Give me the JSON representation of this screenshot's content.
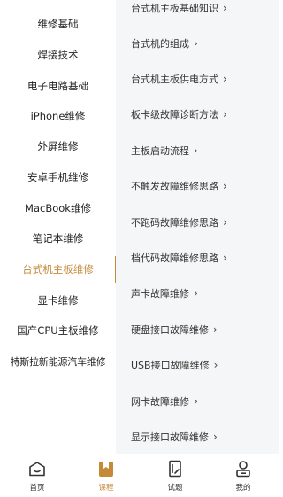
{
  "sidebar": {
    "items": [
      {
        "label": "维修基础"
      },
      {
        "label": "焊接技术"
      },
      {
        "label": "电子电路基础"
      },
      {
        "label": "iPhone维修"
      },
      {
        "label": "外屏维修"
      },
      {
        "label": "安卓手机维修"
      },
      {
        "label": "MacBook维修"
      },
      {
        "label": "笔记本维修"
      },
      {
        "label": "台式机主板维修",
        "active": true
      },
      {
        "label": "显卡维修"
      },
      {
        "label": "国产CPU主板维修"
      },
      {
        "label": "特斯拉新能源汽车维修"
      }
    ]
  },
  "content": {
    "items": [
      {
        "label": "台式机主板基础知识"
      },
      {
        "label": "台式机的组成"
      },
      {
        "label": "台式机主板供电方式"
      },
      {
        "label": "板卡级故障诊断方法"
      },
      {
        "label": "主板启动流程"
      },
      {
        "label": "不触发故障维修思路"
      },
      {
        "label": "不跑码故障维修思路"
      },
      {
        "label": "档代码故障维修思路"
      },
      {
        "label": "声卡故障维修"
      },
      {
        "label": "硬盘接口故障维修"
      },
      {
        "label": "USB接口故障维修"
      },
      {
        "label": "网卡故障维修"
      },
      {
        "label": "显示接口故障维修"
      }
    ],
    "chevron": "›"
  },
  "tabbar": {
    "tabs": [
      {
        "label": "首页",
        "icon": "home-icon"
      },
      {
        "label": "课程",
        "icon": "course-bookmark-icon",
        "active": true
      },
      {
        "label": "试题",
        "icon": "exam-paper-icon"
      },
      {
        "label": "我的",
        "icon": "user-icon"
      }
    ]
  },
  "colors": {
    "accent": "#c48a3a",
    "content_bg": "#f5f6f7",
    "text": "#222222"
  }
}
